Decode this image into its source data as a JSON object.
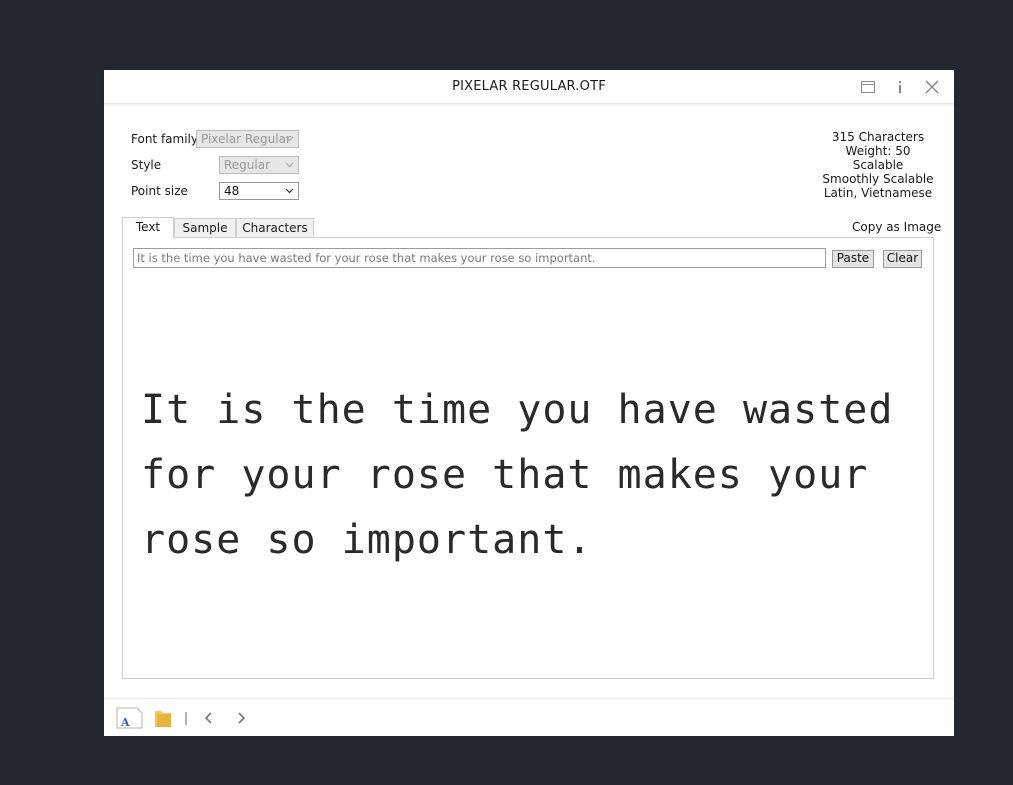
{
  "window": {
    "title": "PIXELAR REGULAR.OTF"
  },
  "titlebar_icons": [
    "panel-icon",
    "info-icon",
    "close-icon"
  ],
  "form": {
    "font_family_label": "Font family",
    "font_family_value": "Pixelar Regular",
    "style_label": "Style",
    "style_value": "Regular",
    "point_size_label": "Point size",
    "point_size_value": "48"
  },
  "info": {
    "characters": "315 Characters",
    "weight": "Weight: 50",
    "scalable": "Scalable",
    "smooth": "Smoothly Scalable",
    "scripts": "Latin, Vietnamese"
  },
  "tabs": [
    {
      "label": "Text",
      "selected": true
    },
    {
      "label": "Sample",
      "selected": false
    },
    {
      "label": "Characters",
      "selected": false
    }
  ],
  "copy_as_image": "Copy as Image",
  "text_panel": {
    "input_value": "It is the time you have wasted for your rose that makes your rose so important.",
    "paste_label": "Paste",
    "clear_label": "Clear",
    "preview_lines": [
      "It is the time you have wasted",
      "for your rose that makes your",
      "rose so important."
    ]
  },
  "statusbar_icons": [
    "font-file-icon",
    "folder-icon",
    "chevron-left-icon",
    "chevron-right-icon"
  ],
  "colors": {
    "desktop_bg": "#232730",
    "window_bg": "#ffffff",
    "preview_text": "#2a2a2a"
  }
}
